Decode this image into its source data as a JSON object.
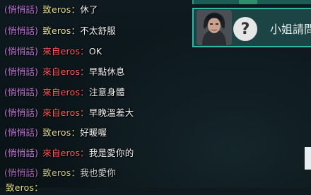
{
  "chat": {
    "whisper_tag": "(悄悄話)",
    "lines": [
      {
        "direction": "out",
        "prefix": "致eros：",
        "text": "休了"
      },
      {
        "direction": "out",
        "prefix": "致eros：",
        "text": "不太舒服"
      },
      {
        "direction": "in",
        "prefix": "來自eros：",
        "text": "OK"
      },
      {
        "direction": "in",
        "prefix": "來自eros：",
        "text": "早點休息"
      },
      {
        "direction": "in",
        "prefix": "來自eros：",
        "text": "注意身體"
      },
      {
        "direction": "in",
        "prefix": "來自eros：",
        "text": "早晚溫差大"
      },
      {
        "direction": "out",
        "prefix": "致eros：",
        "text": "好暖喔"
      },
      {
        "direction": "in",
        "prefix": "來自eros：",
        "text": "我是愛你的"
      },
      {
        "direction": "out",
        "prefix": "致eros：",
        "text": "我也愛你"
      }
    ],
    "input_prefix": "致eros："
  },
  "notification": {
    "label": "小姐請問",
    "icon": "question-mark-icon",
    "glyph": "?"
  },
  "colors": {
    "whisper_tag": "#c77ce0",
    "outgoing": "#e4e08a",
    "incoming": "#ff5c5c",
    "message": "#f2f2f2",
    "notification_border": "#2fb7a7"
  }
}
